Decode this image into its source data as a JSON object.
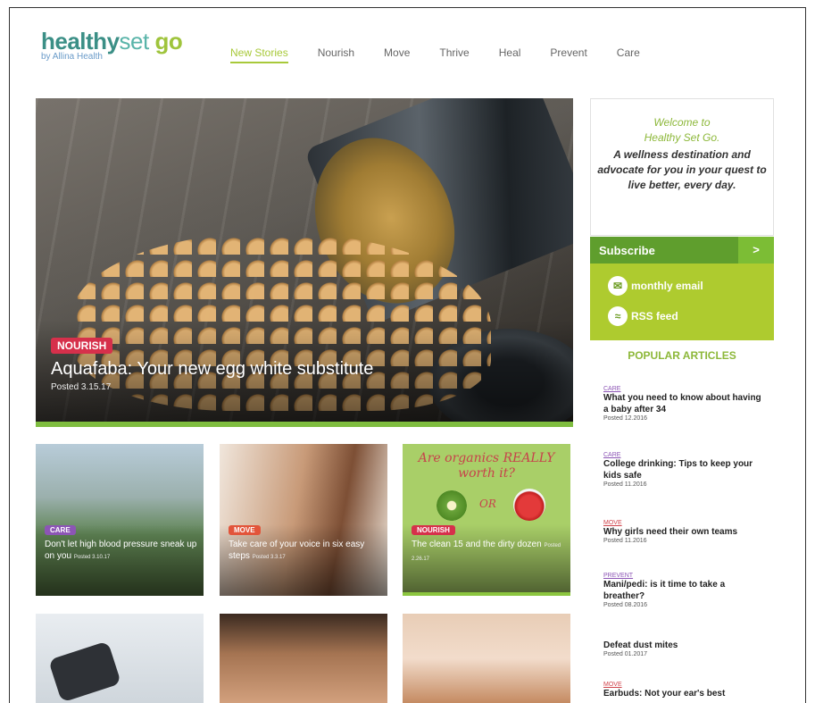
{
  "brand": {
    "word1": "healthy",
    "word2": "set",
    "word3": "go",
    "byline": "by Allina Health"
  },
  "nav": [
    "New Stories",
    "Nourish",
    "Move",
    "Thrive",
    "Heal",
    "Prevent",
    "Care"
  ],
  "hero": {
    "category": "NOURISH",
    "title": "Aquafaba: Your new egg white substitute",
    "posted": "Posted 3.15.17"
  },
  "welcome": {
    "line1": "Welcome to",
    "line2": "Healthy Set Go.",
    "body": "A wellness destination and advocate for you in your quest to live better, every day."
  },
  "subscribe": {
    "label": "Subscribe",
    "arrow": ">",
    "email": "monthly email",
    "rss": "RSS feed"
  },
  "popular": {
    "heading": "POPULAR ARTICLES",
    "items": [
      {
        "cat": "CARE",
        "title": "What you need to know about having a baby after 34",
        "posted": "Posted 12.2016"
      },
      {
        "cat": "CARE",
        "title": "College drinking: Tips to keep your kids safe",
        "posted": "Posted 11.2016"
      },
      {
        "cat": "MOVE",
        "title": "Why girls need their own teams",
        "posted": "Posted 11.2016"
      },
      {
        "cat": "PREVENT",
        "title": "Mani/pedi: is it time to take a breather?",
        "posted": "Posted 08.2016"
      },
      {
        "cat": "",
        "title": "Defeat dust mites",
        "posted": "Posted 01.2017"
      },
      {
        "cat": "MOVE",
        "title": "Earbuds: Not your ear's best",
        "posted": ""
      }
    ]
  },
  "cards": [
    {
      "cat": "CARE",
      "title": "Don't let high blood pressure sneak up on you",
      "posted": "Posted 3.10.17"
    },
    {
      "cat": "MOVE",
      "title": "Take care of your voice in six easy steps",
      "posted": "Posted 3.3.17"
    },
    {
      "cat": "NOURISH",
      "title": "The clean 15 and the dirty dozen",
      "posted": "Posted 2.26.17",
      "headline": "Are organics REALLY worth it?",
      "or": "OR"
    }
  ],
  "colors": {
    "green": "#8db83a",
    "nourish": "#d6304b",
    "care": "#8c55b5",
    "move": "#e2543a"
  }
}
